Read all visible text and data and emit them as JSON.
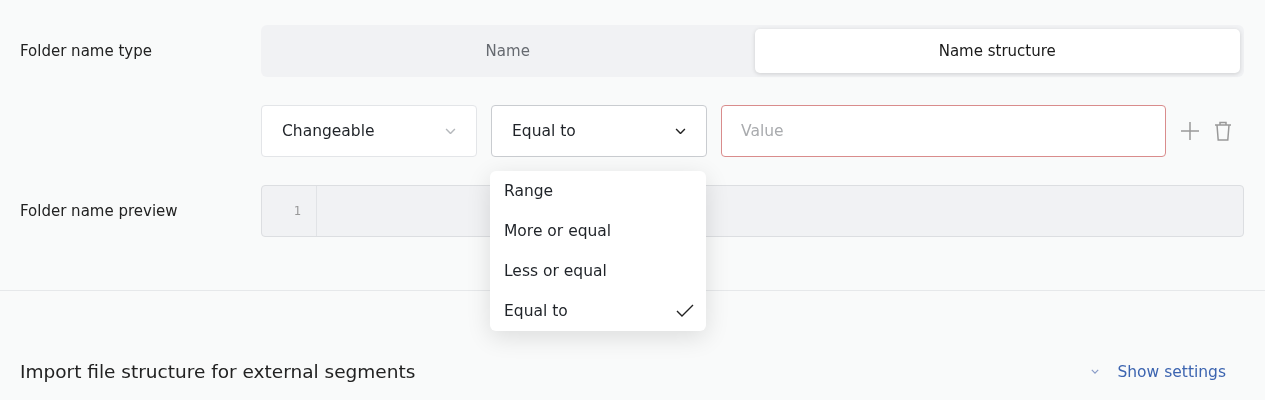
{
  "folder_name_type": {
    "label": "Folder name type",
    "tabs": [
      {
        "label": "Name",
        "selected": false
      },
      {
        "label": "Name structure",
        "selected": true
      }
    ]
  },
  "condition": {
    "field": {
      "value": "Changeable"
    },
    "operator": {
      "value": "Equal to",
      "open": true,
      "options": [
        {
          "label": "Range",
          "selected": false
        },
        {
          "label": "More or equal",
          "selected": false
        },
        {
          "label": "Less or equal",
          "selected": false
        },
        {
          "label": "Equal to",
          "selected": true
        }
      ]
    },
    "value_field": {
      "placeholder": "Value",
      "invalid": true
    }
  },
  "folder_name_preview": {
    "label": "Folder name preview",
    "line_number": "1"
  },
  "import_section": {
    "title": "Import file structure for external segments",
    "toggle": {
      "label": "Show settings",
      "expanded": false
    }
  }
}
